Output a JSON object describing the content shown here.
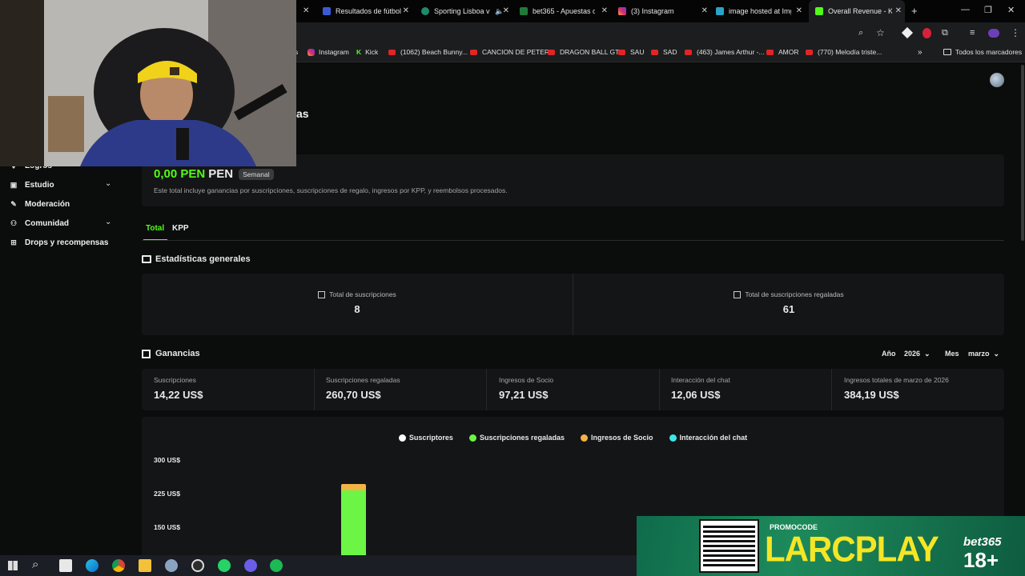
{
  "browser": {
    "tabs": [
      {
        "label": "Resultados de fútbol"
      },
      {
        "label": "Sporting Lisboa v"
      },
      {
        "label": "bet365 - Apuestas de"
      },
      {
        "label": "(3) Instagram"
      },
      {
        "label": "image hosted at Img"
      },
      {
        "label": "Overall Revenue - Ki"
      }
    ],
    "bookmarks": [
      "Instagram",
      "Kick",
      "(1062) Beach Bunny...",
      "CANCION DE PETER",
      "DRAGON BALL GT",
      "SAU",
      "SAD",
      "(463) James Arthur -...",
      "AMOR",
      "(770) Melodía triste..."
    ],
    "all_bookmarks": "Todos los marcadores"
  },
  "sidebar": {
    "items": [
      {
        "label": "Logros"
      },
      {
        "label": "Estudio"
      },
      {
        "label": "Moderación"
      },
      {
        "label": "Comunidad"
      },
      {
        "label": "Drops y recompensas"
      }
    ]
  },
  "header": {
    "title_fragment": "as"
  },
  "summary": {
    "amount": "0,00 PEN",
    "currency": "PEN",
    "period_badge": "Semanal",
    "description": "Este total incluye ganancias por suscripciones, suscripciones de regalo, ingresos por KPP, y reembolsos procesados."
  },
  "tabs": [
    {
      "label": "Total"
    },
    {
      "label": "KPP"
    }
  ],
  "stats": {
    "title": "Estadísticas generales",
    "cards": [
      {
        "label": "Total de suscripciones",
        "value": "8"
      },
      {
        "label": "Total de suscripciones regaladas",
        "value": "61"
      }
    ]
  },
  "earnings": {
    "title": "Ganancias",
    "year_label": "Año",
    "year_value": "2026",
    "month_label": "Mes",
    "month_value": "marzo",
    "cards": [
      {
        "label": "Suscripciones",
        "value": "14,22 US$"
      },
      {
        "label": "Suscripciones regaladas",
        "value": "260,70 US$"
      },
      {
        "label": "Ingresos de Socio",
        "value": "97,21 US$"
      },
      {
        "label": "Interacción del chat",
        "value": "12,06 US$"
      },
      {
        "label": "Ingresos totales de marzo de 2026",
        "value": "384,19 US$"
      }
    ]
  },
  "chart_data": {
    "type": "bar",
    "stacked": true,
    "legend_position": "top-center",
    "yticks": [
      "300 US$",
      "225 US$",
      "150 US$"
    ],
    "ylim": [
      0,
      300
    ],
    "series": [
      {
        "name": "Suscriptores",
        "color": "#ffffff"
      },
      {
        "name": "Suscripciones regaladas",
        "color": "#6cf545"
      },
      {
        "name": "Ingresos de Socio",
        "color": "#f2b544"
      },
      {
        "name": "Interacción del chat",
        "color": "#3ee6e8"
      }
    ],
    "visible_bar": {
      "segments": [
        {
          "series": "Suscripciones regaladas",
          "value_top": 235
        },
        {
          "series": "Ingresos de Socio",
          "value_top": 249
        }
      ]
    }
  },
  "promo": {
    "label": "PROMOCODE",
    "code": "LARCPLAY",
    "brand": "bet365",
    "age": "18+"
  },
  "colors": {
    "accent": "#53fc18",
    "page_bg": "#0b0c0c",
    "card_bg": "#141516"
  }
}
